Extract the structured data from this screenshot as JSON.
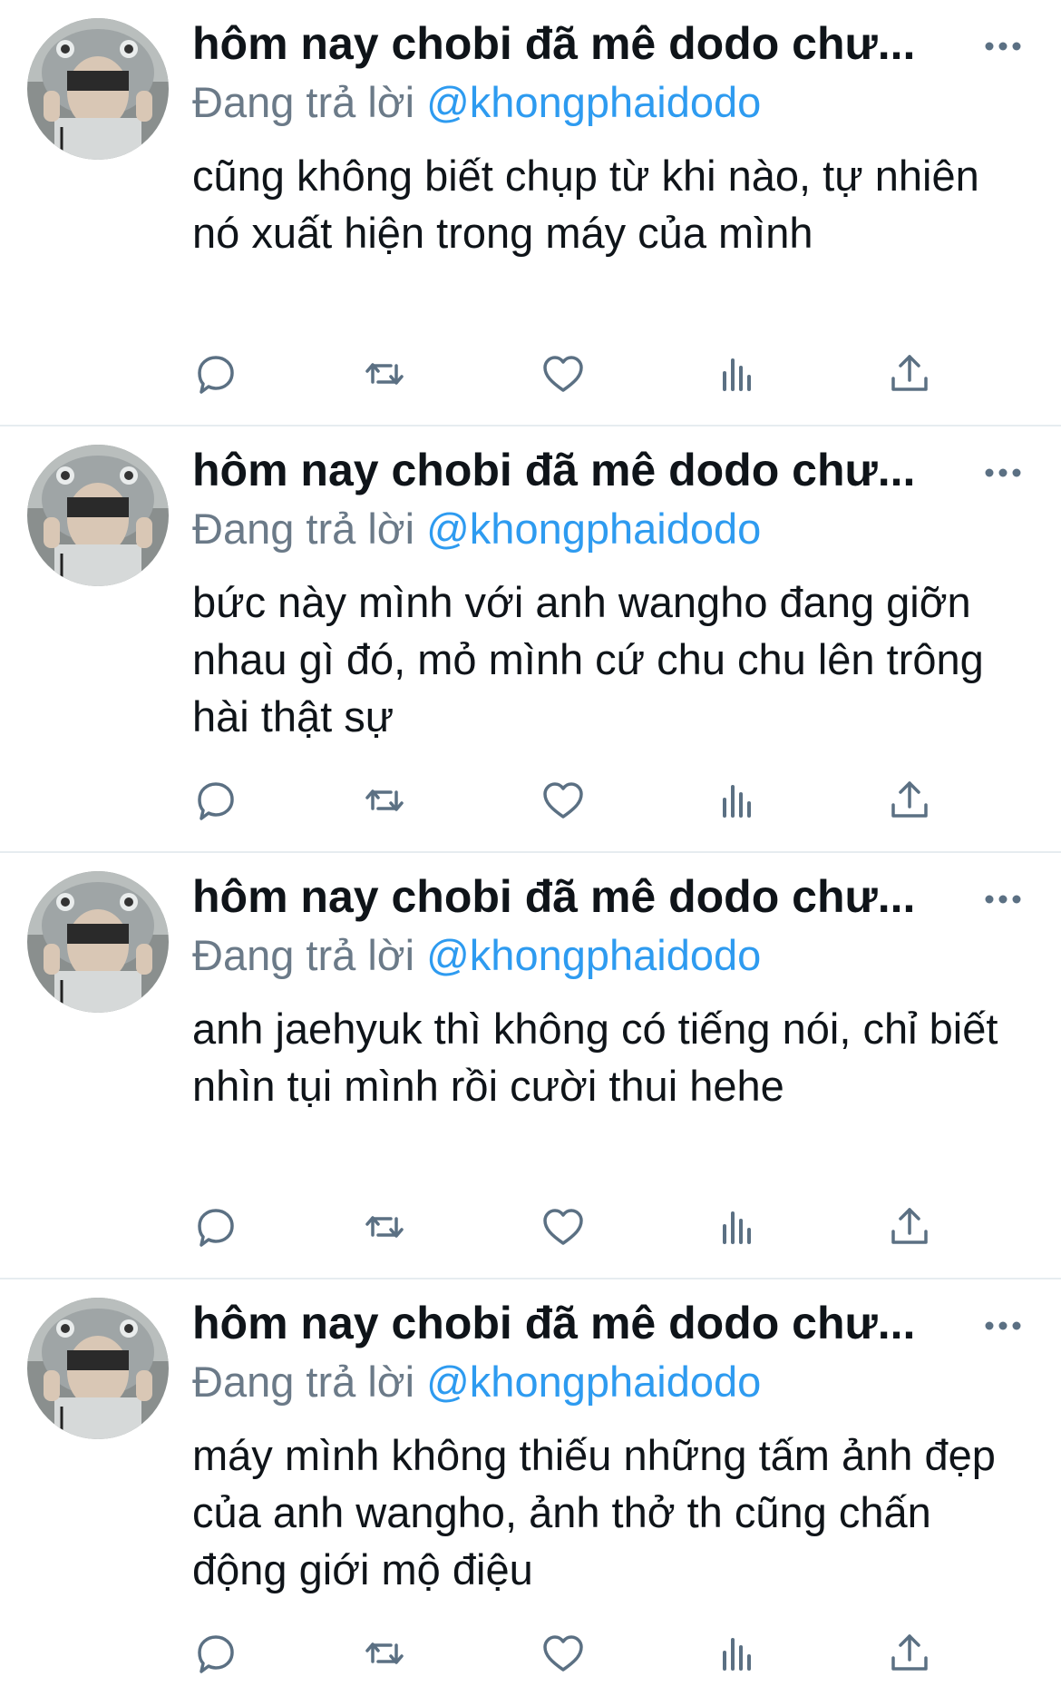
{
  "tweets": [
    {
      "author_name": "hôm nay chobi đã mê dodo chư...",
      "reply_prefix": "Đang trả lời",
      "reply_handle": "@khongphaidodo",
      "body": "cũng không biết chụp từ khi nào, tự nhiên nó xuất hiện trong máy của mình"
    },
    {
      "author_name": "hôm nay chobi đã mê dodo chư...",
      "reply_prefix": "Đang trả lời",
      "reply_handle": "@khongphaidodo",
      "body": "bức này mình với anh wangho đang giỡn nhau gì đó, mỏ mình cứ chu chu lên trông hài thật sự"
    },
    {
      "author_name": "hôm nay chobi đã mê dodo chư...",
      "reply_prefix": "Đang trả lời",
      "reply_handle": "@khongphaidodo",
      "body": "anh jaehyuk thì không có tiếng nói, chỉ biết nhìn tụi mình rồi cười thui hehe"
    },
    {
      "author_name": "hôm nay chobi đã mê dodo chư...",
      "reply_prefix": "Đang trả lời",
      "reply_handle": "@khongphaidodo",
      "body": "máy mình không thiếu những tấm ảnh đẹp của anh wangho, ảnh thở th cũng chấn động giới mộ điệu"
    }
  ],
  "icons": {
    "more": "more-horizontal-icon",
    "reply": "reply-bubble-icon",
    "retweet": "retweet-icon",
    "like": "heart-icon",
    "analytics": "analytics-bars-icon",
    "share": "share-upload-icon"
  },
  "colors": {
    "name": "#0f1419",
    "muted": "#6b7a88",
    "link": "#2e9bf0",
    "icon": "#5b7083",
    "divider": "#e6ecf0"
  }
}
